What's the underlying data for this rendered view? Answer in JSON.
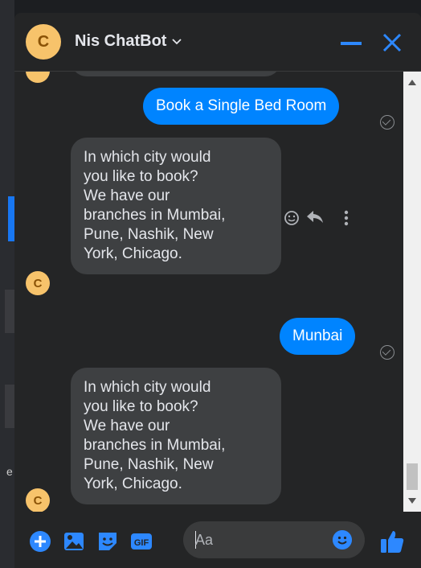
{
  "header": {
    "avatar_letter": "C",
    "title": "Nis ChatBot",
    "chevron": "chevron-down-icon"
  },
  "messages": [
    {
      "from": "user",
      "text": "Book a Single Bed Room"
    },
    {
      "from": "bot",
      "avatar_letter": "C",
      "lines": [
        "In which city would",
        "you like to book?",
        "We have our",
        "branches in Mumbai,",
        "Pune, Nashik, New",
        "York, Chicago."
      ]
    },
    {
      "from": "user",
      "text": "Munbai"
    },
    {
      "from": "bot",
      "avatar_letter": "C",
      "lines": [
        "In which city would",
        "you like to book?",
        "We have our",
        "branches in Mumbai,",
        "Pune, Nashik, New",
        "York, Chicago."
      ]
    }
  ],
  "composer": {
    "placeholder": "Aa"
  },
  "bg": {
    "edge_letter": "e"
  },
  "colors": {
    "accent": "#0084ff",
    "icon_blue": "#2d88ff",
    "avatar": "#f7c36b",
    "bubble_in": "#3e4042"
  }
}
